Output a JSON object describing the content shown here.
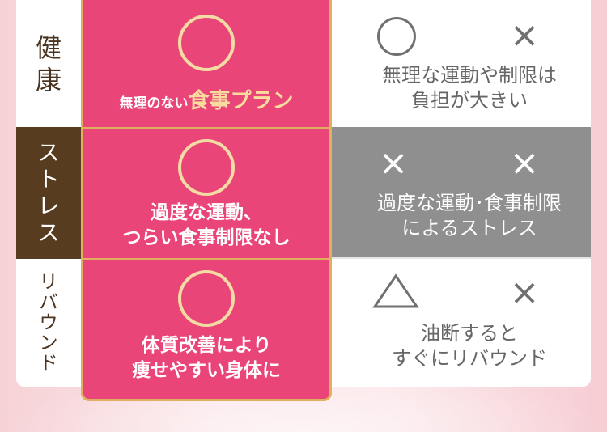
{
  "labels": {
    "health": [
      "健",
      "康"
    ],
    "stress": [
      "ス",
      "ト",
      "レ",
      "ス"
    ],
    "rebound": [
      "リ",
      "バ",
      "ウ",
      "ン",
      "ド"
    ]
  },
  "highlight": {
    "row1_small": "無理のない",
    "row1_big": "食事プラン",
    "row2_line1": "過度な運動、",
    "row2_line2": "つらい食事制限なし",
    "row3_line1": "体質改善により",
    "row3_line2": "痩せやすい身体に"
  },
  "compare": {
    "row1_marks": [
      "○",
      "×"
    ],
    "row1_line1": "無理な運動や制限は",
    "row1_line2": "負担が大きい",
    "row2_marks": [
      "×",
      "×"
    ],
    "row2_line1": "過度な運動･食事制限",
    "row2_line2": "によるストレス",
    "row3_marks": [
      "△",
      "×"
    ],
    "row3_line1": "油断すると",
    "row3_line2": "すぐにリバウンド"
  },
  "colors": {
    "highlight_bg": "#ea4579",
    "highlight_border": "#e0b061",
    "stress_label_bg": "#573c20",
    "stress_row_bg": "#8f8f8f"
  }
}
